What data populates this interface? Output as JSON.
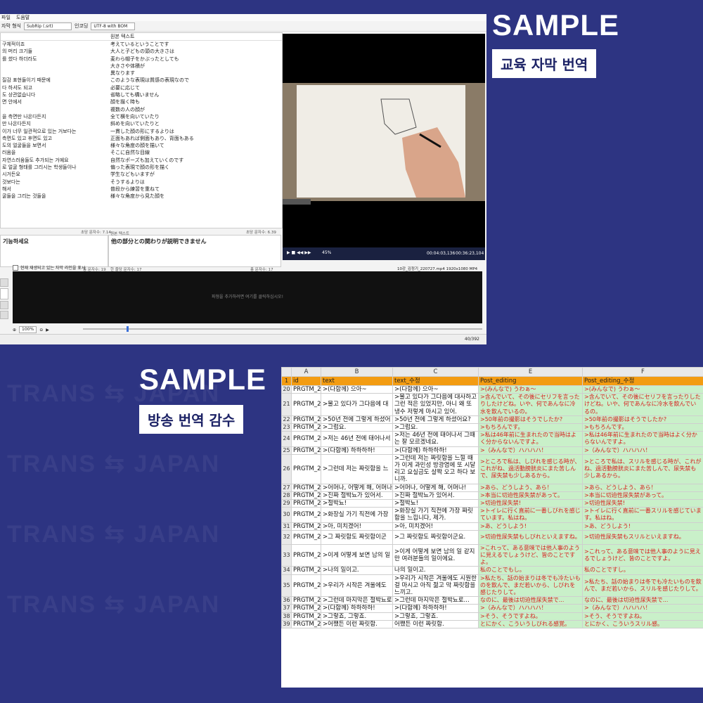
{
  "samples": [
    {
      "title": "SAMPLE",
      "badge": "교육 자막 번역"
    },
    {
      "title": "SAMPLE",
      "badge": "방송 번역 감수"
    }
  ],
  "watermark": "TRANS ⇆ JAPAN",
  "subtitle_app": {
    "menu": [
      "파일",
      "도움말"
    ],
    "format_label": "자막 형식",
    "format_value": "SubRip (.srt)",
    "encoding_label": "인코딩",
    "encoding_value": "UTF-8 with BOM",
    "grid_header_source": "원본 텍스트",
    "rows": [
      {
        "ko": "구체적이죠",
        "ja": "考えているということです"
      },
      {
        "ko": "의 머리 크기들",
        "ja": "大人と子どもの頭の大きさは"
      },
      {
        "ko": "를 썼다 하더라도",
        "ja": "麦わら帽子をかぶったとしても"
      },
      {
        "ko": "",
        "ja": "大きさや体積が"
      },
      {
        "ko": "",
        "ja": "異なります"
      },
      {
        "ko": "질감 표현들이기 때문에",
        "ja": "このような表現は質感の表現なので"
      },
      {
        "ko": "다 하셔도 되고",
        "ja": "必要に応じて"
      },
      {
        "ko": "도 상관없습니다",
        "ja": "省略しても構いません"
      },
      {
        "ko": "면 안에서",
        "ja": "顔を描く時も"
      },
      {
        "ko": "",
        "ja": "複数の人の顔が"
      },
      {
        "ko": "을 측면만 나온다든지",
        "ja": "全て横を向いていたり"
      },
      {
        "ko": "만 나온다든지",
        "ja": "斜めを向いていたりと"
      },
      {
        "ko": "이가 너무 일관적으로 있는 거보다는",
        "ja": "一貫した顔の形にするよりは"
      },
      {
        "ko": "측면도 있고 후면도 있고",
        "ja": "正面もあれば側面もあり、背面もある"
      },
      {
        "ko": "도의 얼굴들을 보면서",
        "ja": "様々な角度の顔を描いて"
      },
      {
        "ko": "러움을",
        "ja": "そこに自然な目線"
      },
      {
        "ko": "자연스러움들도 추가되는 거예요",
        "ja": "自然なポーズも加えていくのです"
      },
      {
        "ko": "로 얼굴 형태를 그리시는 학생들이나",
        "ja": "偏った表現で顔の形を描く"
      },
      {
        "ko": "시거든요",
        "ja": "学生などもいますが"
      },
      {
        "ko": "것보다는",
        "ja": "そうするよりは"
      },
      {
        "ko": "해서",
        "ja": "普段から練習を重ねて"
      },
      {
        "ko": "굴들을 그리는 것들을",
        "ja": "様々な角度から見た顔を"
      }
    ],
    "chars_per_sec_1": "초당 문자수: 7.14",
    "chars_per_sec_2": "초당 문자수: 6.39",
    "edit_label": "원본 텍스트",
    "edit_left": "기능하세요",
    "edit_right": "他の部分との関わりが説明できません",
    "total_chars_1": "총 문자수: 19",
    "line_len": "한 줄당 문자수: 17",
    "total_chars_2": "총 문자수: 17",
    "total_chars_3": "총 문자수: 0",
    "checkbox_label": "현재 재생되고 있는 자막 라인을 표시",
    "file_info": "10강_김정기_220727.mp4 1920x1080 MP4 30.0",
    "wave_hint": "파형을 추가하려면 여기를 클릭하십시오!",
    "zoom": "100%",
    "time_current": "00:04:03,136",
    "time_total": "00:36:23,104",
    "volume": "45%",
    "row_count": "40/392"
  },
  "sheet": {
    "col_letters": [
      "A",
      "B",
      "C",
      "E",
      "F"
    ],
    "headers": [
      "id",
      "text",
      "text_수정",
      "Post_editing",
      "Post_editing_수정"
    ],
    "rows": [
      {
        "n": "20",
        "id": "PRGTM_2(",
        "text": ">(다함께) 으아~",
        "fix": ">(다함께) 으아~",
        "pe": ">(みんなで) うわぁ～",
        "pe2": ">(みんなで) うわぁ～"
      },
      {
        "n": "21",
        "id": "PRGTM_2(",
        "text": ">물고 있다가 그다음에 대",
        "fix": ">물고 있다가 그다음에 대사하고 그런 적은 있었지만, 아니 왜 또 냉수 저렇게 마시고 있어.",
        "pe": ">含んでいて、その後にセリフを言ったりしたけどね。いや、何であんなに冷水を飲んでいるの。",
        "pe2": ">含んでいて、その後にセリフを言ったりしたけどね。いや、何であんなに冷水を飲んでいるの。"
      },
      {
        "n": "22",
        "id": "PRGTM_2(",
        "text": ">50년 전에 그렇게 하셨어",
        "fix": ">50년 전에 그렇게 하셨어요?",
        "pe": ">50年前の撮影はそうでしたか?",
        "pe2": ">50年前の撮影はそうでしたか?"
      },
      {
        "n": "23",
        "id": "PRGTM_2(",
        "text": ">그럼요.",
        "fix": ">그럼요.",
        "pe": ">もちろんです。",
        "pe2": ">もちろんです。"
      },
      {
        "n": "24",
        "id": "PRGTM_2(",
        "text": ">저는 46년 전에 태어나서",
        "fix": ">저는 46년 전에 태어나서 그때는 잘 모르겠네요.",
        "pe": ">私は46年前に生まれたので当時はよく分からないんですよ。",
        "pe2": ">私は46年前に生まれたので当時はよく分からないんですよ。"
      },
      {
        "n": "25",
        "id": "PRGTM_2(",
        "text": ">(다함께) 하하하하!",
        "fix": ">(다함께) 하하하하!",
        "pe": ">（みんなで）ハハハハ！",
        "pe2": ">（みんなで）ハハハハ！"
      },
      {
        "n": "26",
        "id": "PRGTM_2(",
        "text": ">그런데 저는 짜릿함을 느",
        "fix": ">그런데 저는 짜릿함을 느낄 때가 이게 과민성 방광염에 또 시달리고 요실금도 살짝 오고 하다 보니까.",
        "pe": ">ところで私は、しびれを感じる時が、これがね、過活動膀胱炎にまた苦しんで、尿失禁も少しあるから。",
        "pe2": ">ところで私は、スリルを感じる時が、これがね、過活動膀胱炎にまた苦しんで、尿失禁も少しあるから。"
      },
      {
        "n": "27",
        "id": "PRGTM_2(",
        "text": ">어머나, 어떻게 해, 어머나",
        "fix": ">어머나, 어떻게 해, 어머나!",
        "pe": ">あら、どうしよう、あら！",
        "pe2": ">あら、どうしよう、あら！"
      },
      {
        "n": "28",
        "id": "PRGTM_2(",
        "text": ">진짜 절박뇨가 있어서.",
        "fix": ">진짜 절박뇨가 있어서.",
        "pe": ">本当に切迫性尿失禁があって。",
        "pe2": ">本当に切迫性尿失禁があって。"
      },
      {
        "n": "29",
        "id": "PRGTM_2(",
        "text": ">절박뇨!",
        "fix": ">절박뇨!",
        "pe": ">切迫性尿失禁!",
        "pe2": ">切迫性尿失禁!"
      },
      {
        "n": "30",
        "id": "PRGTM_2(",
        "text": ">화장실 가기 직전에 가장",
        "fix": ">화장실 가기 직전에 가장 짜릿함을 느낍니다, 제가.",
        "pe": ">トイレに行く直前に一番しびれを感じています。私はね。",
        "pe2": ">トイレに行く直前に一番スリルを感じています。私はね。"
      },
      {
        "n": "31",
        "id": "PRGTM_2(",
        "text": ">아, 미치겠어!",
        "fix": ">아, 미치겠어!",
        "pe": ">あ、どうしよう!",
        "pe2": ">あ、どうしよう!"
      },
      {
        "n": "32",
        "id": "PRGTM_2(",
        "text": ">그 짜릿함도 짜릿함이군",
        "fix": ">그 짜릿함도 짜릿함이군요.",
        "pe": ">切迫性尿失禁もしびれといえますね。",
        "pe2": ">切迫性尿失禁もスリルといえますね。"
      },
      {
        "n": "33",
        "id": "PRGTM_2(",
        "text": ">이게 어떻게 보면 남의 일",
        "fix": ">이게 어떻게 보면 남의 일 같지만 여러분들의 일이에요.",
        "pe": ">これって、ある意味では他人事のように見えるでしょうけど、皆のことですよ。",
        "pe2": ">これって、ある意味では他人事のように見えるでしょうけど、皆のことですよ。"
      },
      {
        "n": "34",
        "id": "PRGTM_2(",
        "text": ">나의 일이고.",
        "fix": "나의 일이고.",
        "pe": "私のことでもし。",
        "pe2": "私のことですし。"
      },
      {
        "n": "35",
        "id": "PRGTM_2(",
        "text": ">우리가 시작은 겨울에도",
        "fix": ">우리가 시작은 겨울에도 시원한 걸 마시고 아직 젊고 막 짜릿함을 느끼고.",
        "pe": ">私たち、話の始まりは冬でも冷たいものを飲んで、まだ若いから、しびれを感じたりして。",
        "pe2": ">私たち、話の始まりは冬でも冷たいものを飲んで、まだ若いから、スリルを感じたりして。"
      },
      {
        "n": "36",
        "id": "PRGTM_2(",
        "text": ">그런데 마지막은 절박뇨로",
        "fix": ">그런데 마지막은 절박뇨로...",
        "pe": "なのに、最後は切迫性尿失禁で...",
        "pe2": "なのに、最後は切迫性尿失禁で..."
      },
      {
        "n": "37",
        "id": "PRGTM_2(",
        "text": ">(다함께) 하하하하!",
        "fix": ">(다함께) 하하하하!",
        "pe": ">（みんなで）ハハハハ！",
        "pe2": ">（みんなで）ハハハハ！"
      },
      {
        "n": "38",
        "id": "PRGTM_2(",
        "text": ">그렇죠, 그렇죠.",
        "fix": ">그렇죠, 그렇죠.",
        "pe": ">そう、そうですよね。",
        "pe2": ">そう、そうですよね。"
      },
      {
        "n": "39",
        "id": "PRGTM_2(",
        "text": ">어쨌든 이런 짜릿함.",
        "fix": "어쨌든 이런 짜릿함.",
        "pe": "とにかく、こういうしびれる感覚。",
        "pe2": "とにかく、こういうスリル感。"
      }
    ]
  },
  "colors": {
    "background": "#2d3482",
    "header_orange": "#f39c12",
    "post_edit_green": "#c9f0c9",
    "jp_red": "#d81b1b"
  }
}
